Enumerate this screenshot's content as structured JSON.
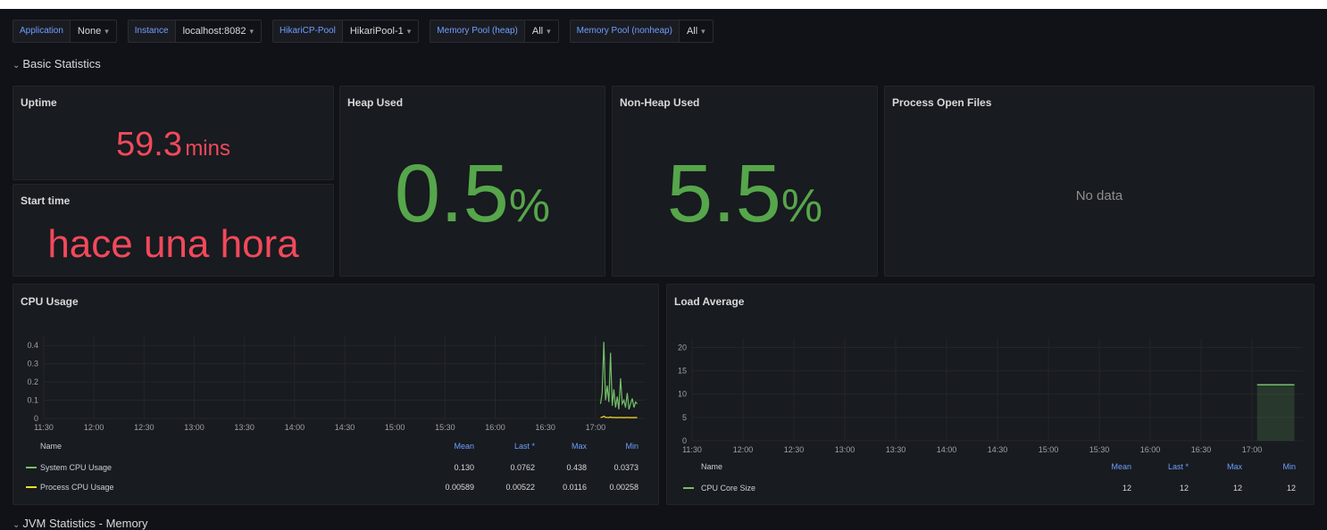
{
  "variables": [
    {
      "label": "Application",
      "value": "None"
    },
    {
      "label": "Instance",
      "value": "localhost:8082"
    },
    {
      "label": "HikariCP-Pool",
      "value": "HikariPool-1"
    },
    {
      "label": "Memory Pool (heap)",
      "value": "All"
    },
    {
      "label": "Memory Pool (nonheap)",
      "value": "All"
    }
  ],
  "row_basic": {
    "title": "Basic Statistics"
  },
  "uptime": {
    "title": "Uptime",
    "value": "59.3",
    "unit": "mins"
  },
  "start_time": {
    "title": "Start time",
    "value": "hace una hora"
  },
  "heap_used": {
    "title": "Heap Used",
    "value": "0.5",
    "unit": "%"
  },
  "nonheap_used": {
    "title": "Non-Heap Used",
    "value": "5.5",
    "unit": "%"
  },
  "open_files": {
    "title": "Process Open Files",
    "nodata": "No data"
  },
  "cpu_usage": {
    "title": "CPU Usage",
    "legend_headers": {
      "name": "Name",
      "mean": "Mean",
      "last": "Last *",
      "max": "Max",
      "min": "Min"
    },
    "legend": [
      {
        "name": "System CPU Usage",
        "mean": "0.130",
        "last": "0.0762",
        "max": "0.438",
        "min": "0.0373",
        "color": "#73bf69"
      },
      {
        "name": "Process CPU Usage",
        "mean": "0.00589",
        "last": "0.00522",
        "max": "0.0116",
        "min": "0.00258",
        "color": "#fade2a"
      }
    ]
  },
  "load_average": {
    "title": "Load Average",
    "legend_headers": {
      "name": "Name",
      "mean": "Mean",
      "last": "Last *",
      "max": "Max",
      "min": "Min"
    },
    "legend": [
      {
        "name": "CPU Core Size",
        "mean": "12",
        "last": "12",
        "max": "12",
        "min": "12",
        "color": "#73bf69"
      }
    ]
  },
  "chart_data": [
    {
      "type": "line",
      "title": "CPU Usage",
      "x_ticks": [
        "11:30",
        "12:00",
        "12:30",
        "13:00",
        "13:30",
        "14:00",
        "14:30",
        "15:00",
        "15:30",
        "16:00",
        "16:30",
        "17:00"
      ],
      "y_ticks": [
        "0",
        "0.1",
        "0.2",
        "0.3",
        "0.4"
      ],
      "ylim": [
        0,
        0.45
      ],
      "x": [
        "17:03",
        "17:04",
        "17:05",
        "17:06",
        "17:07",
        "17:08",
        "17:09",
        "17:10",
        "17:11",
        "17:12",
        "17:13",
        "17:14",
        "17:15",
        "17:16",
        "17:17",
        "17:18",
        "17:19",
        "17:20",
        "17:21",
        "17:22",
        "17:23",
        "17:24",
        "17:25"
      ],
      "series": [
        {
          "name": "System CPU Usage",
          "color": "#73bf69",
          "values": [
            0.08,
            0.14,
            0.42,
            0.1,
            0.18,
            0.09,
            0.36,
            0.07,
            0.16,
            0.06,
            0.12,
            0.05,
            0.22,
            0.08,
            0.1,
            0.06,
            0.14,
            0.05,
            0.08,
            0.11,
            0.06,
            0.09,
            0.08
          ]
        },
        {
          "name": "Process CPU Usage",
          "color": "#fade2a",
          "values": [
            0.006,
            0.007,
            0.012,
            0.006,
            0.006,
            0.005,
            0.008,
            0.005,
            0.006,
            0.005,
            0.005,
            0.005,
            0.006,
            0.005,
            0.005,
            0.005,
            0.006,
            0.005,
            0.005,
            0.005,
            0.005,
            0.005,
            0.005
          ]
        }
      ],
      "grid": true
    },
    {
      "type": "area",
      "title": "Load Average",
      "x_ticks": [
        "11:30",
        "12:00",
        "12:30",
        "13:00",
        "13:30",
        "14:00",
        "14:30",
        "15:00",
        "15:30",
        "16:00",
        "16:30",
        "17:00"
      ],
      "y_ticks": [
        "0",
        "5",
        "10",
        "15",
        "20"
      ],
      "ylim": [
        0,
        22
      ],
      "x": [
        "17:03",
        "17:25"
      ],
      "series": [
        {
          "name": "CPU Core Size",
          "color": "#73bf69",
          "values": [
            12,
            12
          ]
        }
      ],
      "grid": true
    }
  ],
  "row_jvm": {
    "title": "JVM Statistics - Memory"
  }
}
